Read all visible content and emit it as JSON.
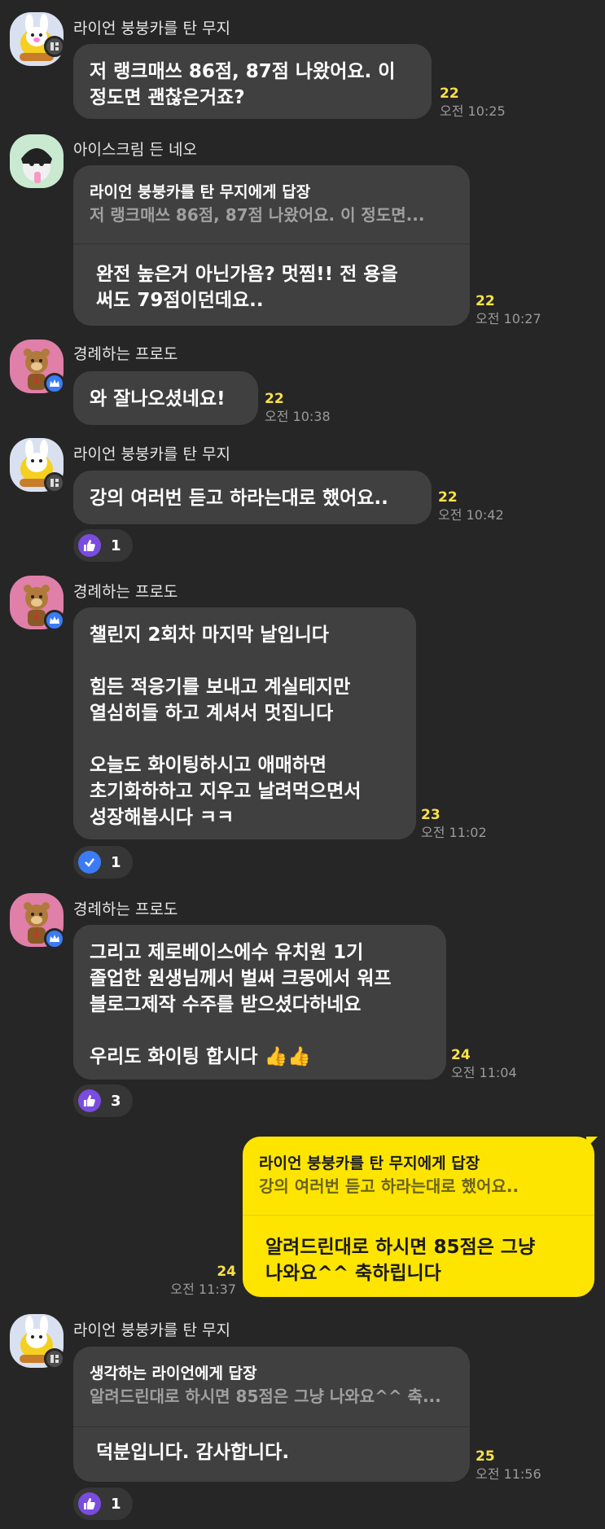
{
  "messages": [
    {
      "sender": "라이언 붕붕카를 탄 무지",
      "lines": [
        "저 랭크매쓰 86점, 87점 나왔어요. 이",
        "정도면 괜찮은거죠?"
      ],
      "unread": "22",
      "time": "오전 10:25"
    },
    {
      "sender": "아이스크림 든 네오",
      "reply_title": "라이언 붕붕카를 탄 무지에게 답장",
      "reply_quote": "저 랭크매쓰 86점, 87점 나왔어요. 이 정도면...",
      "lines": [
        "완전 높은거 아닌가욤? 멋찜!! 전 용을",
        "써도 79점이던데요.."
      ],
      "unread": "22",
      "time": "오전 10:27"
    },
    {
      "sender": "경례하는 프로도",
      "lines": [
        "와 잘나오셨네요!"
      ],
      "unread": "22",
      "time": "오전 10:38"
    },
    {
      "sender": "라이언 붕붕카를 탄 무지",
      "lines": [
        "강의 여러번 듣고 하라는대로 했어요.."
      ],
      "unread": "22",
      "time": "오전 10:42",
      "reaction_count": "1"
    },
    {
      "sender": "경례하는 프로도",
      "lines": [
        "챌린지 2회차 마지막 날입니다",
        "",
        "힘든 적응기를 보내고 계실테지만",
        "열심히들 하고 계셔서 멋집니다",
        "",
        "오늘도 화이팅하시고 애매하면",
        "초기화하하고 지우고 날려먹으면서",
        "성장해봅시다 ㅋㅋ"
      ],
      "unread": "23",
      "time": "오전 11:02",
      "reaction_count": "1"
    },
    {
      "sender": "경례하는 프로도",
      "lines": [
        "그리고 제로베이스에수 유치원 1기",
        "졸업한 원생님께서 벌써 크몽에서 워프",
        "블로그제작 수주를 받으셨다하네요",
        "",
        "우리도 화이팅 합시다 👍👍"
      ],
      "unread": "24",
      "time": "오전 11:04",
      "reaction_count": "3"
    },
    {
      "sender": "",
      "reply_title": "라이언 붕붕카를 탄 무지에게 답장",
      "reply_quote": "강의 여러번 듣고 하라는대로 했어요..",
      "lines": [
        "알려드린대로 하시면 85점은 그냥",
        "나와요^^ 축하립니다"
      ],
      "unread": "24",
      "time": "오전 11:37"
    },
    {
      "sender": "라이언 붕붕카를 탄 무지",
      "reply_title": "생각하는 라이언에게 답장",
      "reply_quote": "알려드린대로 하시면 85점은 그냥 나와요^^ 축...",
      "lines": [
        "덕분입니다. 감사합니다."
      ],
      "unread": "25",
      "time": "오전 11:56",
      "reaction_count": "1"
    }
  ],
  "colors": {
    "background": "#262626",
    "bubble_other": "#404040",
    "bubble_mine": "#fee500",
    "unread": "#f7e14b",
    "time": "#9a9a9a",
    "reaction_like": "#7a4ce0",
    "reaction_check": "#3b7cf5"
  },
  "icons": {
    "muzi_avatar": "muzi-avatar-icon",
    "neo_avatar": "neo-avatar-icon",
    "frodo_avatar": "frodo-avatar-icon",
    "like_reaction": "thumbs-up-icon",
    "check_reaction": "check-icon",
    "manager_badge": "crown-icon",
    "member_badge": "profile-badge-icon"
  }
}
